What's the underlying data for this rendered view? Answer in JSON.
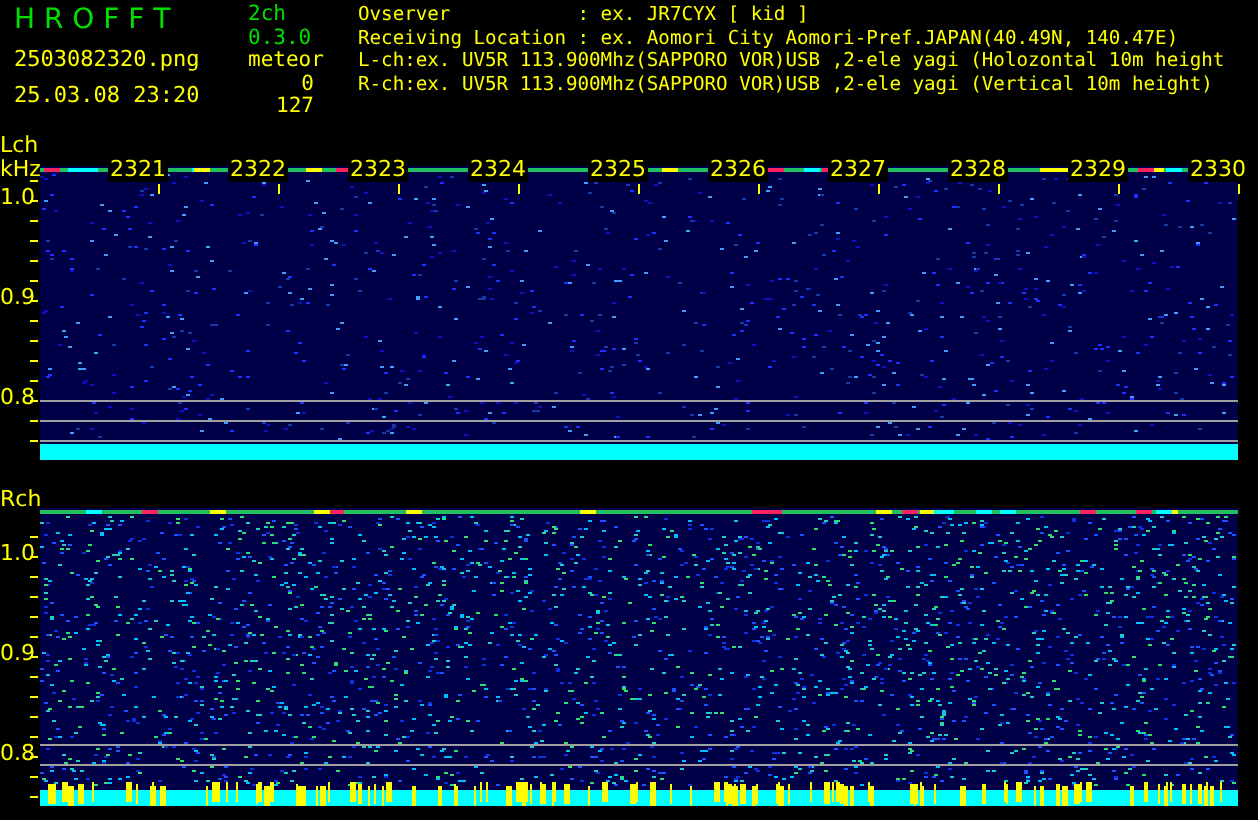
{
  "header": {
    "app_title": "H R O F F T",
    "version": "2ch 0.3.0",
    "file_name": "2503082320.png",
    "date_time": "25.03.08 23:20",
    "meteor_label": "meteor",
    "meteor_counts": [
      "0",
      "127"
    ],
    "info_lines": [
      "Ovserver           : ex. JR7CYX [ kid ]",
      "Receiving Location : ex. Aomori City Aomori-Pref.JAPAN(40.49N, 140.47E)",
      "L-ch:ex. UV5R 113.900Mhz(SAPPORO VOR)USB ,2-ele yagi (Holozontal 10m height",
      "R-ch:ex. UV5R 113.900Mhz(SAPPORO VOR)USB ,2-ele yagi (Vertical 10m height)"
    ]
  },
  "channels": [
    {
      "label": "Lch",
      "unit": "kHz",
      "y_ticks": [
        "1.0",
        "0.9",
        "0.8"
      ],
      "time_labels": [
        "2321",
        "2322",
        "2323",
        "2324",
        "2325",
        "2326",
        "2327",
        "2328",
        "2329",
        "2330"
      ],
      "kind": "left"
    },
    {
      "label": "Rch",
      "y_ticks": [
        "1.0",
        "0.9",
        "0.8"
      ],
      "kind": "right"
    }
  ]
}
